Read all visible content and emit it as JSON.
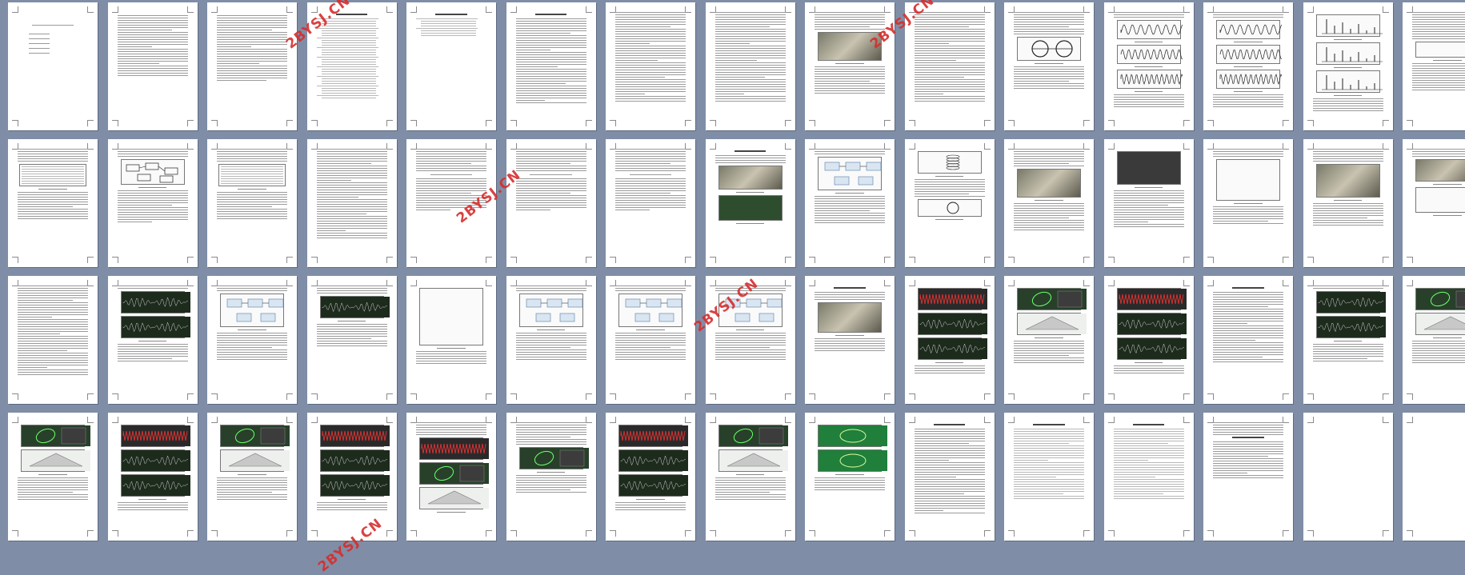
{
  "viewer": {
    "rows": 4,
    "cols": 15,
    "page_count": 60,
    "colors": {
      "background": "#7f8ea6",
      "page": "#ffffff",
      "watermark": "#d62d2d"
    }
  },
  "cover": {
    "title": "毕业论文"
  },
  "abstract_title": "摘要",
  "abstract_en_title": "Abstract",
  "watermark_text": "2BYSJ.CN",
  "pages": [
    {
      "kind": "cover"
    },
    {
      "kind": "abstract"
    },
    {
      "kind": "abstract-en"
    },
    {
      "kind": "toc"
    },
    {
      "kind": "toc2"
    },
    {
      "kind": "chapter"
    },
    {
      "kind": "text"
    },
    {
      "kind": "text"
    },
    {
      "kind": "fig-photo"
    },
    {
      "kind": "text"
    },
    {
      "kind": "fig-wheel"
    },
    {
      "kind": "wave"
    },
    {
      "kind": "wave"
    },
    {
      "kind": "spectrum"
    },
    {
      "kind": "text-fig"
    },
    {
      "kind": "table"
    },
    {
      "kind": "diagram"
    },
    {
      "kind": "table"
    },
    {
      "kind": "text"
    },
    {
      "kind": "formula"
    },
    {
      "kind": "formula"
    },
    {
      "kind": "formula"
    },
    {
      "kind": "fig-photo2"
    },
    {
      "kind": "block"
    },
    {
      "kind": "coil"
    },
    {
      "kind": "fig-photo"
    },
    {
      "kind": "fig-device"
    },
    {
      "kind": "fig-board"
    },
    {
      "kind": "fig-photo3"
    },
    {
      "kind": "fig-photo4"
    },
    {
      "kind": "text"
    },
    {
      "kind": "scope"
    },
    {
      "kind": "block"
    },
    {
      "kind": "scope2"
    },
    {
      "kind": "block-tall"
    },
    {
      "kind": "block"
    },
    {
      "kind": "block"
    },
    {
      "kind": "block"
    },
    {
      "kind": "chapter-photo"
    },
    {
      "kind": "scope-red"
    },
    {
      "kind": "scope-ellipse"
    },
    {
      "kind": "scope-red"
    },
    {
      "kind": "text-list"
    },
    {
      "kind": "scope"
    },
    {
      "kind": "scope-ellipse"
    },
    {
      "kind": "scope-ellipse"
    },
    {
      "kind": "scope-red"
    },
    {
      "kind": "scope-ellipse"
    },
    {
      "kind": "scope-red"
    },
    {
      "kind": "scope-tri"
    },
    {
      "kind": "text-scope"
    },
    {
      "kind": "scope-red"
    },
    {
      "kind": "scope-ellipse"
    },
    {
      "kind": "scope-green"
    },
    {
      "kind": "chapter"
    },
    {
      "kind": "refs"
    },
    {
      "kind": "refs"
    },
    {
      "kind": "ack"
    },
    {
      "kind": "blank"
    },
    {
      "kind": "blank"
    }
  ]
}
